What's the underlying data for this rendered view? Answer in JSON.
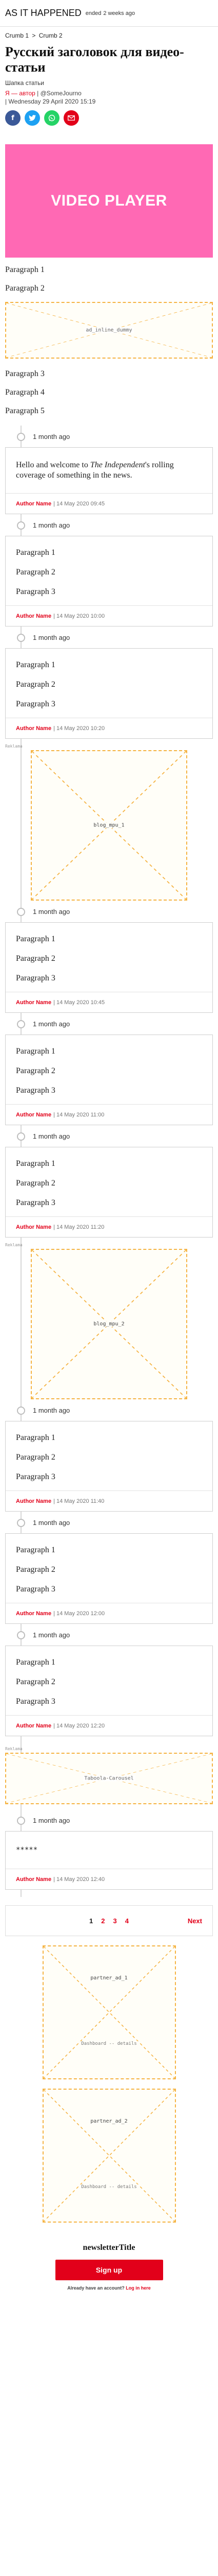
{
  "header": {
    "title": "AS IT HAPPENED",
    "status": "ended",
    "ago": "2 weeks ago"
  },
  "breadcrumb": [
    "Crumb 1",
    ">",
    "Crumb 2"
  ],
  "article": {
    "headline": "Русский заголовок для видео-статьи",
    "subhead": "Шапка статьи",
    "author": "Я — автор",
    "handle": "| @SomeJourno",
    "date": "| Wednesday 29 April 2020 15:19"
  },
  "share_icons": [
    "facebook-icon",
    "twitter-icon",
    "whatsapp-icon",
    "email-icon"
  ],
  "video": {
    "label": "VIDEO PLAYER"
  },
  "intro_paragraphs": [
    "Paragraph 1",
    "Paragraph 2"
  ],
  "ad_1": {
    "label": "ad_inline_dummy"
  },
  "more_paragraphs": [
    "Paragraph 3",
    "Paragraph 4",
    "Paragraph 5"
  ],
  "entries": [
    {
      "time": "1 month ago",
      "author": "Author Name",
      "date": "| 14 May 2020 09:45",
      "intro": [
        "Hello and welcome to ",
        "The Independent",
        "'s rolling coverage of something in the news."
      ]
    },
    {
      "time": "1 month ago",
      "author": "Author Name",
      "date": "| 14 May 2020 10:00",
      "paragraphs": [
        "Paragraph 1",
        "Paragraph 2",
        "Paragraph 3"
      ]
    },
    {
      "time": "1 month ago",
      "author": "Author Name",
      "date": "| 14 May 2020 10:20",
      "paragraphs": [
        "Paragraph 1",
        "Paragraph 2",
        "Paragraph 3"
      ]
    },
    {
      "time": "1 month ago",
      "author": "Author Name",
      "date": "| 14 May 2020 10:45",
      "paragraphs": [
        "Paragraph 1",
        "Paragraph 2",
        "Paragraph 3"
      ]
    },
    {
      "time": "1 month ago",
      "author": "Author Name",
      "date": "| 14 May 2020 11:00",
      "paragraphs": [
        "Paragraph 1",
        "Paragraph 2",
        "Paragraph 3"
      ]
    },
    {
      "time": "1 month ago",
      "author": "Author Name",
      "date": "| 14 May 2020 11:20",
      "paragraphs": [
        "Paragraph 1",
        "Paragraph 2",
        "Paragraph 3"
      ]
    },
    {
      "time": "1 month ago",
      "author": "Author Name",
      "date": "| 14 May 2020 11:40",
      "paragraphs": [
        "Paragraph 1",
        "Paragraph 2",
        "Paragraph 3"
      ]
    },
    {
      "time": "1 month ago",
      "author": "Author Name",
      "date": "| 14 May 2020 12:00",
      "paragraphs": [
        "Paragraph 1",
        "Paragraph 2",
        "Paragraph 3"
      ]
    },
    {
      "time": "1 month ago",
      "author": "Author Name",
      "date": "| 14 May 2020 12:20",
      "paragraphs": [
        "Paragraph 1",
        "Paragraph 2",
        "Paragraph 3"
      ]
    },
    {
      "time": "1 month ago",
      "author": "Author Name",
      "date": "| 14 May 2020 12:40",
      "paragraphs": [
        "*****"
      ]
    }
  ],
  "blog_ads": [
    {
      "tag": "Reklama",
      "label": "blog_mpu_1"
    },
    {
      "tag": "Reklama",
      "label": "blog_mpu_2"
    },
    {
      "tag": "Reklama",
      "label": "Taboola-Carousel"
    }
  ],
  "pagination": {
    "pages": [
      "1",
      "2",
      "3",
      "4"
    ],
    "next": "Next"
  },
  "partners": [
    {
      "label": "partner_ad_1",
      "sub": "Dashboard -- details"
    },
    {
      "label": "partner_ad_2",
      "sub": "Dashboard -- details"
    }
  ],
  "newsletter": {
    "title": "newsletterTitle",
    "button": "Sign up",
    "login_prefix": "Already have an account?",
    "login_link": "Log in here"
  },
  "colors": {
    "accent": "#e2001a",
    "video_bg": "#ff69b4",
    "ad_border": "#f5b342"
  }
}
